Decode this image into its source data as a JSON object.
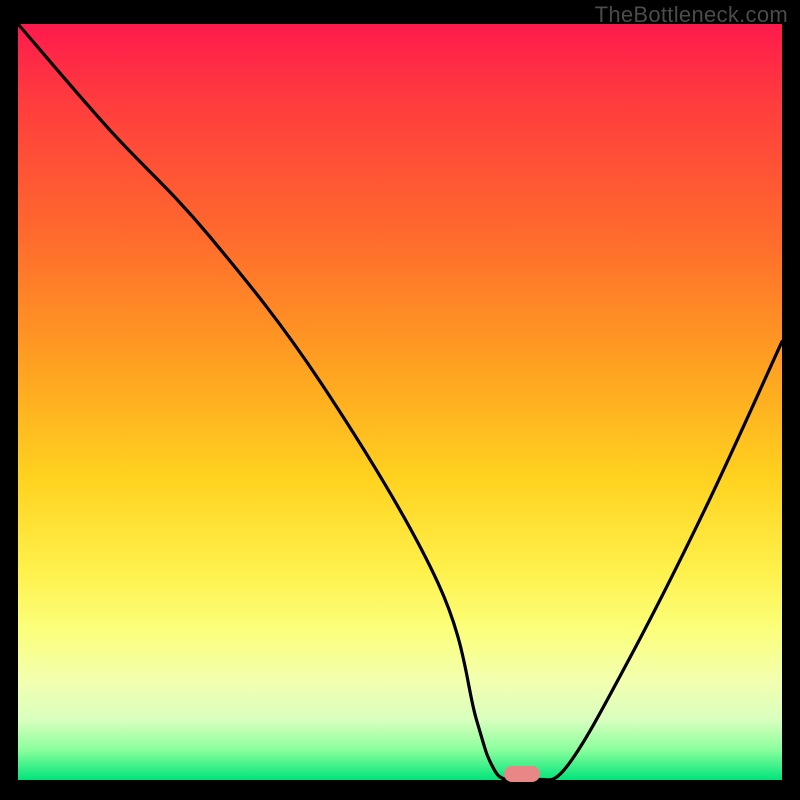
{
  "watermark": "TheBottleneck.com",
  "chart_data": {
    "type": "line",
    "title": "",
    "xlabel": "",
    "ylabel": "",
    "xlim": [
      0,
      100
    ],
    "ylim": [
      0,
      100
    ],
    "grid": false,
    "legend": false,
    "series": [
      {
        "name": "curve",
        "x": [
          0,
          12,
          25,
          40,
          55,
          60,
          62,
          64,
          68,
          72,
          80,
          90,
          100
        ],
        "y": [
          100,
          86,
          72,
          52,
          26,
          8,
          2,
          0,
          0,
          2,
          16,
          36,
          58
        ]
      }
    ],
    "marker": {
      "x": 66,
      "y": 0.8,
      "color": "#e98686"
    },
    "background_gradient": {
      "direction": "vertical",
      "stops": [
        {
          "pos": 0.0,
          "color": "#ff1a4d"
        },
        {
          "pos": 0.28,
          "color": "#ff6a2d"
        },
        {
          "pos": 0.6,
          "color": "#ffd21f"
        },
        {
          "pos": 0.8,
          "color": "#fbff7a"
        },
        {
          "pos": 0.96,
          "color": "#8bff9d"
        },
        {
          "pos": 1.0,
          "color": "#00e47a"
        }
      ]
    }
  }
}
